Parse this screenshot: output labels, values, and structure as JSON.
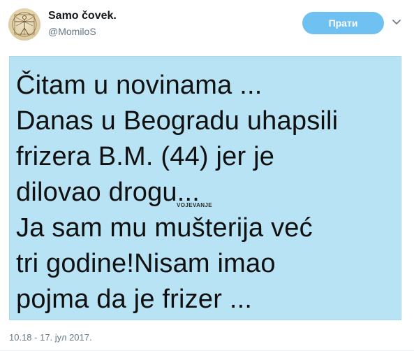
{
  "author": {
    "name": "Samo čovek.",
    "handle": "@MomiloS",
    "avatar_icon": "vitruvian-man-avatar"
  },
  "follow_button": {
    "label": "Прати"
  },
  "more_icon": "chevron-down-icon",
  "media": {
    "background_color": "#b7e3f5",
    "lines": [
      "Čitam u novinama ...",
      "Danas u Beogradu uhapsili",
      "frizera B.M. (44) jer je",
      "dilovao drogu...",
      "Ja sam mu mušterija već",
      "tri godine!Nisam imao",
      "pojma da je frizer ..."
    ],
    "watermark": "VOJEVANJE"
  },
  "timestamp": "10.18 - 17. јул 2017.",
  "colors": {
    "follow_button": "#6fc1f1",
    "secondary_text": "#657786"
  }
}
